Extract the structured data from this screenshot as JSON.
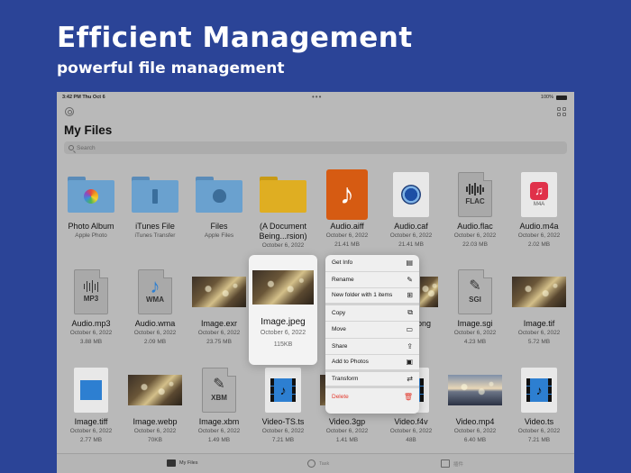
{
  "hero": {
    "title": "Efficient Management",
    "subtitle": "powerful file management"
  },
  "status": {
    "time": "3:42 PM   Thu Oct 6",
    "battery": "100%"
  },
  "page": {
    "title": "My Files"
  },
  "search": {
    "placeholder": "Search"
  },
  "files": [
    {
      "name": "Photo Album",
      "m1": "Apple Photo",
      "m2": "",
      "icon": "photo-album-folder-icon"
    },
    {
      "name": "iTunes File",
      "m1": "iTunes Transfer",
      "m2": "",
      "icon": "itunes-folder-icon"
    },
    {
      "name": "Files",
      "m1": "Apple Files",
      "m2": "",
      "icon": "apple-files-folder-icon"
    },
    {
      "name": "(A Document Being...rsion)",
      "m1": "October 6, 2022",
      "m2": "",
      "icon": "yellow-folder-icon"
    },
    {
      "name": "Audio.aiff",
      "m1": "October 6, 2022",
      "m2": "21.41 MB",
      "icon": "aiff-icon"
    },
    {
      "name": "Audio.caf",
      "m1": "October 6, 2022",
      "m2": "21.41 MB",
      "icon": "caf-icon"
    },
    {
      "name": "Audio.flac",
      "m1": "October 6, 2022",
      "m2": "22.03 MB",
      "icon": "flac-icon"
    },
    {
      "name": "Audio.m4a",
      "m1": "October 6, 2022",
      "m2": "2.02 MB",
      "icon": "m4a-icon"
    },
    {
      "name": "Audio.mp3",
      "m1": "October 6, 2022",
      "m2": "3.88 MB",
      "icon": "mp3-icon"
    },
    {
      "name": "Audio.wma",
      "m1": "October 6, 2022",
      "m2": "2.09 MB",
      "icon": "wma-icon"
    },
    {
      "name": "Image.exr",
      "m1": "October 6, 2022",
      "m2": "23.75 MB",
      "icon": "image-thumb"
    },
    {
      "name": "Image.png",
      "m1": "October 6, 2022",
      "m2": "",
      "icon": "image-thumb"
    },
    {
      "name": "Image.sgi",
      "m1": "October 6, 2022",
      "m2": "4.23 MB",
      "icon": "sgi-icon"
    },
    {
      "name": "Image.tif",
      "m1": "October 6, 2022",
      "m2": "5.72 MB",
      "icon": "image-thumb"
    },
    {
      "name": "Image.tiff",
      "m1": "October 6, 2022",
      "m2": "2.77 MB",
      "icon": "tiff-icon"
    },
    {
      "name": "Image.webp",
      "m1": "October 6, 2022",
      "m2": "70KB",
      "icon": "image-thumb"
    },
    {
      "name": "Image.xbm",
      "m1": "October 6, 2022",
      "m2": "1.49 MB",
      "icon": "xbm-icon"
    },
    {
      "name": "Video-TS.ts",
      "m1": "October 6, 2022",
      "m2": "7.21 MB",
      "icon": "video-icon"
    },
    {
      "name": "Video.3gp",
      "m1": "October 6, 2022",
      "m2": "1.41 MB",
      "icon": "video-thumb"
    },
    {
      "name": "Video.f4v",
      "m1": "October 6, 2022",
      "m2": "48B",
      "icon": "video-icon"
    },
    {
      "name": "Video.mp4",
      "m1": "October 6, 2022",
      "m2": "6.40 MB",
      "icon": "video-thumb"
    },
    {
      "name": "Video.ts",
      "m1": "October 6, 2022",
      "m2": "7.21 MB",
      "icon": "video-icon"
    }
  ],
  "preview": {
    "name": "Image.jpeg",
    "date": "October 6, 2022",
    "size": "115KB"
  },
  "menu": [
    {
      "label": "Get Info",
      "icon": "info-icon"
    },
    {
      "label": "Rename",
      "icon": "pencil-icon"
    },
    {
      "label": "New folder with 1 items",
      "icon": "new-folder-icon"
    },
    {
      "label": "Copy",
      "icon": "copy-icon"
    },
    {
      "label": "Move",
      "icon": "folder-icon"
    },
    {
      "label": "Share",
      "icon": "share-icon"
    },
    {
      "label": "Add to Photos",
      "icon": "photo-icon"
    },
    {
      "label": "Transform",
      "icon": "transform-icon"
    },
    {
      "label": "Delete",
      "icon": "trash-icon"
    }
  ],
  "tabs": [
    {
      "label": "My Files"
    },
    {
      "label": "Task"
    },
    {
      "label": "插件"
    }
  ]
}
